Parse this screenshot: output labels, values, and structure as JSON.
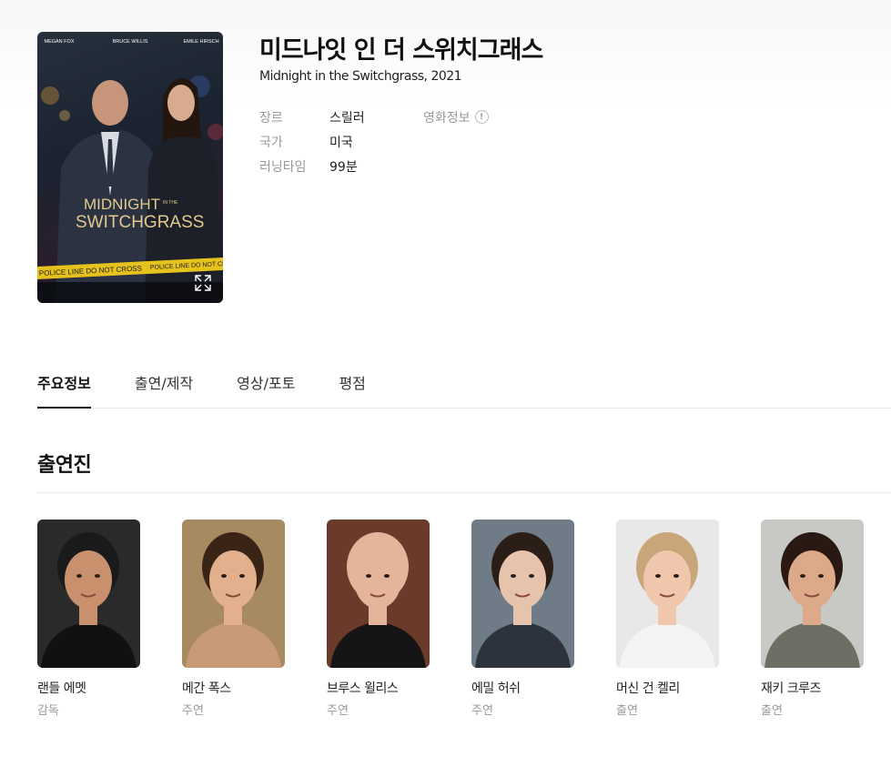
{
  "movie": {
    "title": "미드나잇 인 더 스위치그래스",
    "subtitle": "Midnight in the Switchgrass, 2021",
    "poster": {
      "top_names": [
        "MEGAN FOX",
        "BRUCE WILLIS",
        "EMILE HIRSCH"
      ],
      "headline_1": "MIDNIGHT",
      "headline_in": "IN THE",
      "headline_2": "SWITCHGRASS",
      "tape_text": "POLICE LINE DO NOT CROSS"
    }
  },
  "info": {
    "rows": [
      {
        "label": "장르",
        "value": "스릴러"
      },
      {
        "label": "국가",
        "value": "미국"
      },
      {
        "label": "러닝타임",
        "value": "99분"
      }
    ],
    "link_label": "영화정보",
    "link_icon": "info-circle-icon"
  },
  "tabs": [
    {
      "label": "주요정보",
      "active": true
    },
    {
      "label": "출연/제작",
      "active": false
    },
    {
      "label": "영상/포토",
      "active": false
    },
    {
      "label": "평점",
      "active": false
    }
  ],
  "cast_section": {
    "title": "출연진",
    "members": [
      {
        "name": "랜들 에멧",
        "role": "감독",
        "bg": "#2a2a2a",
        "skin": "#c9906e",
        "hair": "#1a1a1a",
        "shirt": "#111111"
      },
      {
        "name": "메간 폭스",
        "role": "주연",
        "bg": "#a88a62",
        "skin": "#e2b08c",
        "hair": "#3a2416",
        "shirt": "#c99a78"
      },
      {
        "name": "브루스 윌리스",
        "role": "주연",
        "bg": "#6a3a2a",
        "skin": "#e4b59a",
        "hair": "#e4b59a",
        "shirt": "#151515"
      },
      {
        "name": "에밀 허쉬",
        "role": "주연",
        "bg": "#6f7c88",
        "skin": "#e6c3ad",
        "hair": "#2b1e17",
        "shirt": "#2c333c"
      },
      {
        "name": "머신 건 켈리",
        "role": "출연",
        "bg": "#e8e8e8",
        "skin": "#f0c6ad",
        "hair": "#c9a57a",
        "shirt": "#f4f4f4"
      },
      {
        "name": "재키 크루즈",
        "role": "출연",
        "bg": "#c8c9c4",
        "skin": "#dcaa88",
        "hair": "#2a1812",
        "shirt": "#6b6f64"
      }
    ]
  },
  "icons": {
    "expand": "expand-icon"
  }
}
